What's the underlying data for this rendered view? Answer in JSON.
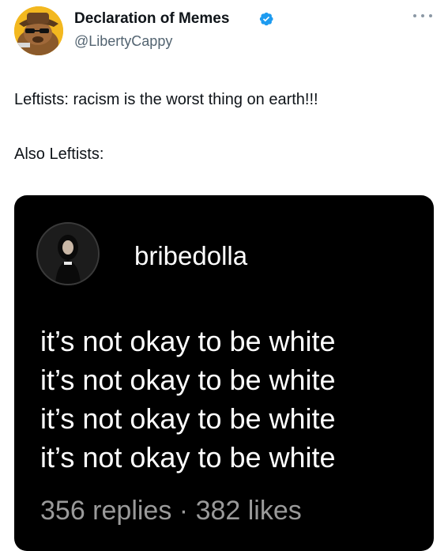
{
  "tweet": {
    "display_name": "Declaration of Memes",
    "handle": "@LibertyCappy",
    "line1": "Leftists: racism is the worst thing on earth!!!",
    "line2": "Also Leftists:"
  },
  "icons": {
    "verified": "verified-badge-icon",
    "more": "more-options-icon"
  },
  "colors": {
    "verified_blue": "#1d9bf0",
    "card_bg": "#000000",
    "stats_gray": "#9a9a9a"
  },
  "embedded_post": {
    "username": "bribedolla",
    "lines": [
      "it’s not okay to be white",
      "it’s not okay to be white",
      "it’s not okay to be white",
      "it’s not okay to be white"
    ],
    "replies": "356 replies",
    "separator": " · ",
    "likes": "382 likes"
  }
}
